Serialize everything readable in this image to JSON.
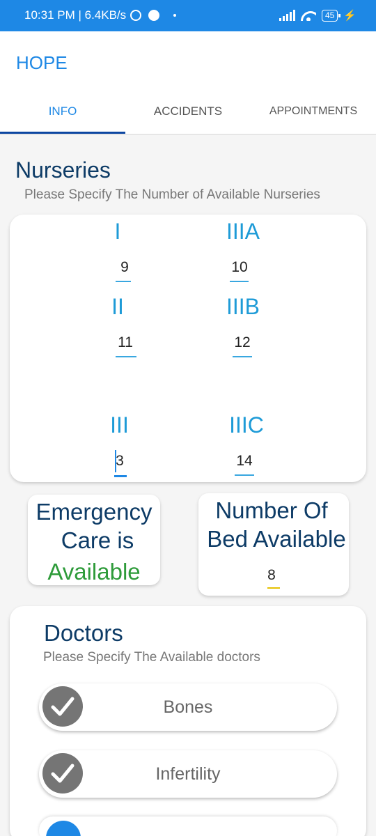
{
  "status_bar": {
    "time_speed": "10:31 PM | 6.4KB/s",
    "battery": "45"
  },
  "app": {
    "title": "HOPE"
  },
  "tabs": [
    {
      "label": "INFO"
    },
    {
      "label": "ACCIDENTS"
    },
    {
      "label": "APPOINTMENTS"
    }
  ],
  "nurseries": {
    "title": "Nurseries",
    "subtitle": "Please Specify The Number of Available Nurseries",
    "items": [
      {
        "label": "I",
        "value": "9"
      },
      {
        "label": "IIIA",
        "value": "10"
      },
      {
        "label": "II",
        "value": "11"
      },
      {
        "label": "IIIB",
        "value": "12"
      },
      {
        "label": "III",
        "value": "3"
      },
      {
        "label": "IIIC",
        "value": "14"
      }
    ]
  },
  "emergency": {
    "line1": "Emergency",
    "line2": "Care is",
    "status": "Available"
  },
  "beds": {
    "line1": "Number Of",
    "line2": "Bed Available",
    "value": "8"
  },
  "doctors": {
    "title": "Doctors",
    "subtitle": "Please Specify The Available doctors",
    "items": [
      {
        "label": "Bones",
        "checked": true
      },
      {
        "label": "Infertility",
        "checked": true
      }
    ]
  },
  "colors": {
    "accent": "#1e88e5",
    "nursery_label": "#1e9bd7",
    "available": "#2e9b3a",
    "bed_underline": "#e6c100"
  }
}
